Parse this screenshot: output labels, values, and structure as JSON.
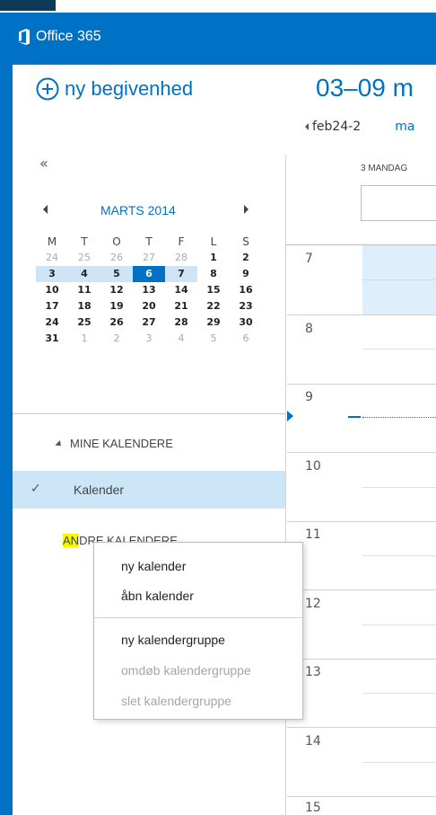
{
  "header": {
    "app_title": "Office 365"
  },
  "sidebar": {
    "new_event_label": "ny begivenhed",
    "collapse_glyph": "«",
    "mini_calendar": {
      "month_label": "MARTS 2014",
      "weekdays": [
        "M",
        "T",
        "O",
        "T",
        "F",
        "L",
        "S"
      ],
      "weeks": [
        [
          "24",
          "25",
          "26",
          "27",
          "28",
          "1",
          "2"
        ],
        [
          "3",
          "4",
          "5",
          "6",
          "7",
          "8",
          "9"
        ],
        [
          "10",
          "11",
          "12",
          "13",
          "14",
          "15",
          "16"
        ],
        [
          "17",
          "18",
          "19",
          "20",
          "21",
          "22",
          "23"
        ],
        [
          "24",
          "25",
          "26",
          "27",
          "28",
          "29",
          "30"
        ],
        [
          "31",
          "1",
          "2",
          "3",
          "4",
          "5",
          "6"
        ]
      ],
      "today": "6"
    },
    "my_calendars_heading": "MINE KALENDERE",
    "calendar_item": "Kalender",
    "other_calendars_heading_hl": "AN",
    "other_calendars_heading_rest": "DRE KALENDERE"
  },
  "main": {
    "week_range": "03–09 m",
    "nav_prev_label": "feb24-2",
    "nav_next_label": "ma",
    "day_header": "3 MANDAG",
    "hours": [
      "7",
      "8",
      "9",
      "10",
      "11",
      "12",
      "13",
      "14",
      "15"
    ]
  },
  "context_menu": {
    "items": [
      {
        "label": "ny kalender",
        "enabled": true
      },
      {
        "label": "åbn kalender",
        "enabled": true
      },
      {
        "label": "ny kalendergruppe",
        "enabled": true
      },
      {
        "label": "omdøb kalendergruppe",
        "enabled": false
      },
      {
        "label": "slet kalendergruppe",
        "enabled": false
      }
    ]
  },
  "colors": {
    "accent": "#0072c6",
    "selection": "#cde6f7",
    "highlight": "#f7f700"
  },
  "icons": {
    "logo": "office-logo-icon",
    "new_event": "plus-circle-icon",
    "check": "check-icon"
  }
}
